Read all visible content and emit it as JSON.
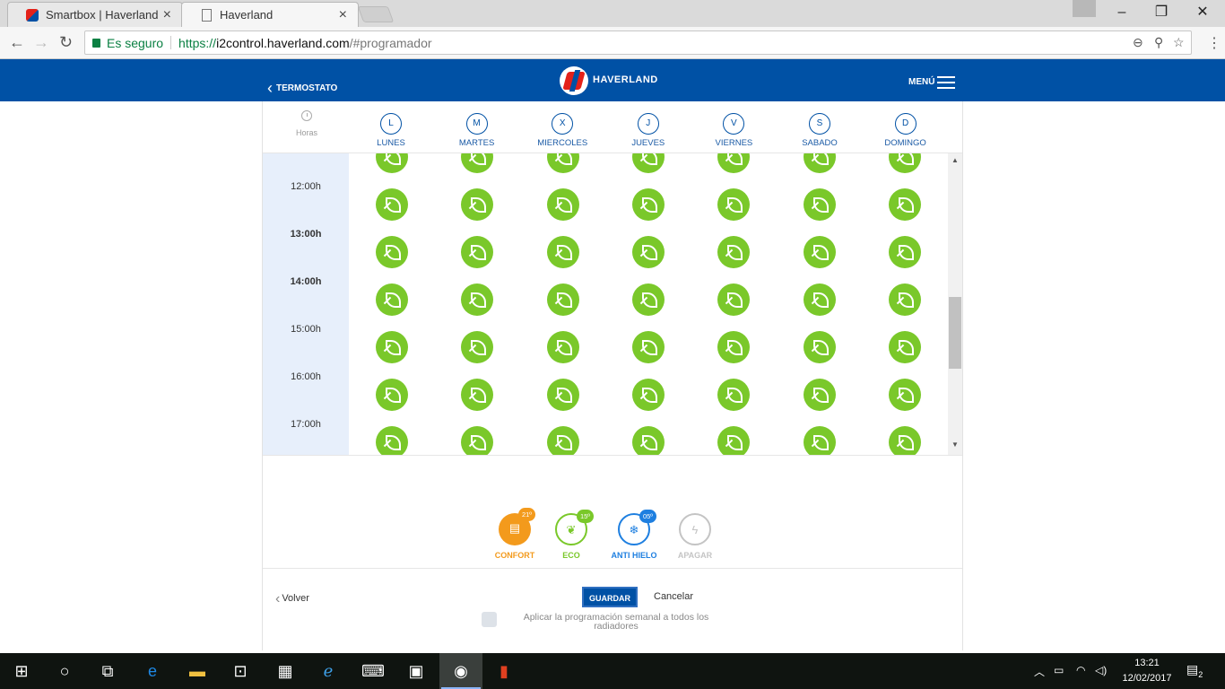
{
  "browser": {
    "tabs": [
      {
        "title": "Smartbox | Haverland",
        "close": "×"
      },
      {
        "title": "Haverland",
        "close": "×"
      }
    ],
    "secure_label": "Es seguro",
    "url_scheme": "https://",
    "url_host": "i2control.haverland.com",
    "url_path": "/#programador"
  },
  "header": {
    "back_label": "TERMOSTATO",
    "logo_text": "HAVERLAND",
    "menu_label": "MENÚ"
  },
  "schedule": {
    "hours_header": "Horas",
    "days": [
      {
        "letter": "L",
        "name": "LUNES"
      },
      {
        "letter": "M",
        "name": "MARTES"
      },
      {
        "letter": "X",
        "name": "MIERCOLES"
      },
      {
        "letter": "J",
        "name": "JUEVES"
      },
      {
        "letter": "V",
        "name": "VIERNES"
      },
      {
        "letter": "S",
        "name": "SABADO"
      },
      {
        "letter": "D",
        "name": "DOMINGO"
      }
    ],
    "hours": [
      "12:00h",
      "13:00h",
      "14:00h",
      "15:00h",
      "16:00h",
      "17:00h"
    ],
    "bold_hours": [
      "13:00h",
      "14:00h"
    ],
    "cell_mode": "eco",
    "cell_rows_visible": 7
  },
  "modes": [
    {
      "label": "CONFORT",
      "temp": "21º",
      "color": "#f39a1c",
      "icon": "heater-icon"
    },
    {
      "label": "ECO",
      "temp": "15º",
      "color": "#7ac82a",
      "icon": "leaf-icon"
    },
    {
      "label": "ANTI HIELO",
      "temp": "05º",
      "color": "#1e7fe0",
      "icon": "snowflake-icon"
    },
    {
      "label": "APAGAR",
      "temp": "",
      "color": "#c4c4c4",
      "icon": "power-icon"
    }
  ],
  "footer": {
    "back_label": "Volver",
    "save_label": "GUARDAR",
    "cancel_label": "Cancelar",
    "apply_all_label": "Aplicar la programación semanal a todos los radiadores"
  },
  "taskbar": {
    "time": "13:21",
    "date": "12/02/2017",
    "notifications": "2"
  },
  "colors": {
    "brand": "#0051a5",
    "eco": "#7ac82a",
    "confort": "#f39a1c",
    "antihielo": "#1e7fe0"
  }
}
